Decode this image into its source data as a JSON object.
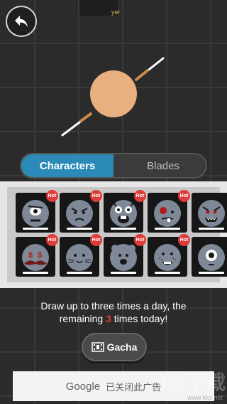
{
  "header": {
    "back_label": "back"
  },
  "tabs": [
    {
      "label": "Characters",
      "active": true
    },
    {
      "label": "Blades",
      "active": false
    }
  ],
  "tab_overlap_text": "yer",
  "characters": [
    {
      "id": "one-eyed-angry",
      "badge": "Hot"
    },
    {
      "id": "frowning",
      "badge": "Hot"
    },
    {
      "id": "bunny-teeth",
      "badge": "Hot"
    },
    {
      "id": "zombie",
      "badge": "Hot"
    },
    {
      "id": "monster",
      "badge": ""
    },
    {
      "id": "money-mustache",
      "badge": "Hot"
    },
    {
      "id": "cat",
      "badge": "Hot"
    },
    {
      "id": "bear",
      "badge": "Hot"
    },
    {
      "id": "freckles-smile",
      "badge": "Hot"
    },
    {
      "id": "cyclops",
      "badge": ""
    }
  ],
  "info": {
    "line1": "Draw up to three times a day, the",
    "line2_prefix": "remaining ",
    "remaining": "3",
    "line2_suffix": " times today!"
  },
  "gacha": {
    "label": "Gacha"
  },
  "ad": {
    "brand": "Google",
    "text": "已关闭此广告"
  },
  "watermark": {
    "logo": "KK下载",
    "url": "www.kkx.net"
  },
  "colors": {
    "accent": "#2b8ab8",
    "hot": "#e03b3b",
    "hero": "#e8b07e"
  }
}
